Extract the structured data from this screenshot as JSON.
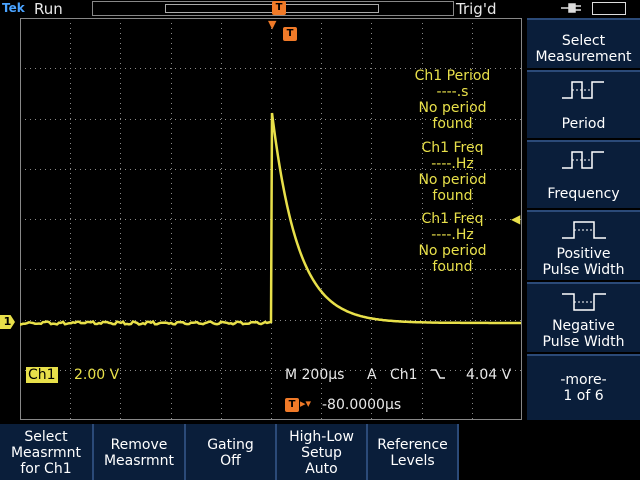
{
  "topbar": {
    "logo": "Tek",
    "acq_state": "Run",
    "trigger_state": "Trig'd"
  },
  "colors": {
    "trace": "#e8e04a",
    "trigger": "#f07a28",
    "menu_bg": "#0a1e3a"
  },
  "icons": [
    "plug-icon",
    "battery-icon",
    "trigger-position-icon",
    "channel-1-marker-icon",
    "trigger-level-arrow-icon"
  ],
  "markers": {
    "channel": "1",
    "trigger": "T"
  },
  "measurements": [
    {
      "title": "Ch1 Period",
      "value": "----.s",
      "status1": "No period",
      "status2": "found"
    },
    {
      "title": "Ch1 Freq",
      "value": "----.Hz",
      "status1": "No period",
      "status2": "found"
    },
    {
      "title": "Ch1 Freq",
      "value": "----.Hz",
      "status1": "No period",
      "status2": "found"
    }
  ],
  "status": {
    "channel": "Ch1",
    "volts_div": "2.00 V",
    "timebase": "M 200µs",
    "trig_mode": "A",
    "trig_source": "Ch1",
    "trig_level": "4.04 V",
    "trig_offset": "-80.0000µs"
  },
  "side_menu": {
    "title1": "Select",
    "title2": "Measurement",
    "items": [
      {
        "label1": "Period",
        "label2": ""
      },
      {
        "label1": "Frequency",
        "label2": ""
      },
      {
        "label1": "Positive",
        "label2": "Pulse Width"
      },
      {
        "label1": "Negative",
        "label2": "Pulse Width"
      }
    ],
    "more1": "-more-",
    "more2": "1 of 6"
  },
  "bottom_menu": [
    {
      "line1": "Select",
      "line2": "Measrmnt",
      "line3": "for Ch1"
    },
    {
      "line1": "Remove",
      "line2": "Measrmnt",
      "line3": ""
    },
    {
      "line1": "Gating",
      "line2": "Off",
      "line3": ""
    },
    {
      "line1": "High-Low",
      "line2": "Setup",
      "line3": "Auto"
    },
    {
      "line1": "Reference",
      "line2": "Levels",
      "line3": ""
    }
  ]
}
